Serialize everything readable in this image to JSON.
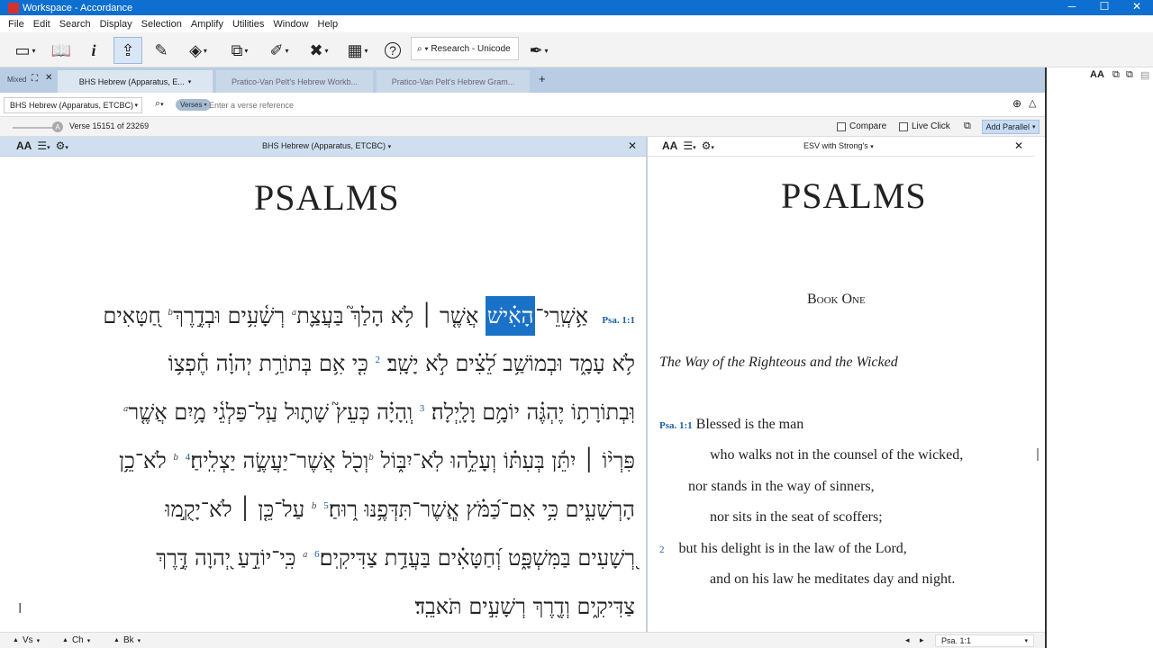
{
  "window": {
    "title": "Workspace - Accordance",
    "min": "─",
    "max": "☐",
    "close": "✕"
  },
  "menu": [
    "File",
    "Edit",
    "Search",
    "Display",
    "Selection",
    "Amplify",
    "Utilities",
    "Window",
    "Help"
  ],
  "toolbar": {
    "research_label": "⌕ ▾ Research - Unicode"
  },
  "tabs": {
    "mixed": "Mixed",
    "items": [
      "BHS Hebrew (Apparatus, E...",
      "Pratico-Van Pelt's Hebrew Workb...",
      "Pratico-Van Pelt's Hebrew Gram..."
    ],
    "add": "+"
  },
  "search": {
    "module": "BHS Hebrew (Apparatus, ETCBC)",
    "mode": "Verses",
    "placeholder": "Enter a verse reference"
  },
  "status": {
    "verse_count": "Verse 15151 of 23269",
    "compare": "Compare",
    "live_click": "Live Click",
    "add_parallel": "Add Parallel"
  },
  "left_pane": {
    "title": "BHS Hebrew (Apparatus, ETCBC)",
    "book": "PSALMS",
    "ref": "Psa. 1:1",
    "highlight": "הָאִ֗ישׁ",
    "line1_a": "אַ֥שְֽׁרֵי־",
    "line1_b": "אֲשֶׁ֤ר ׀ לֹ֥א הָלַךְ֮ בַּעֲצַ֪ת",
    "line1_c": " רְשָׁ֫עִ֥ים וּבְדֶ֣רֶךְ",
    "line1_d": " חַ֭טָּאִים",
    "line2": "לֹ֥א עָמָ֑ד וּבְמוֹשַׁ֥ב לֵ֝צִ֗ים לֹ֣א יָשָֽׁב׃",
    "line2_v": "2",
    "line2_b": "כִּ֤י אִ֥ם בְּתוֹרַ֥ת יְהוָ֗ה חֶ֫פְצ֥וֹ",
    "line3": "וּֽבְתוֹרָת֥וֹ יֶהְגֶּ֗ה יוֹמָ֥ם וָלָֽיְלָה׃",
    "line3_v": "3",
    "line3_b": "וְֽהָיָ֗ה כְּעֵץ֮ שָׁת֪וּל עַֽל־פַּלְגֵ֫י מָ֥יִם אֲשֶׁ֤ר",
    "line4_a": "פִּרְי֨וֹ ׀ יִתֵּ֬ן בְּעִתּ֗וֹ וְעָלֵ֥הוּ לֹֽא־יִבּ֑וֹל",
    "line4_b": "וְכֹ֖ל אֲשֶׁר־יַעֲשֶׂ֣ה יַצְלִֽיחַ׃",
    "line4_v": "4",
    "line4_c": "לֹא־כֵ֥ן",
    "line5_a": "הָרְשָׁעִ֑ים כִּ֥י אִם־כַּ֝מֹּ֗ץ אֲֽשֶׁר־תִּדְּפֶ֥נּוּ ר֑וּחַ׃",
    "line5_v": "5",
    "line5_b": "עַל־כֵּ֤ן ׀ לֹא־יָקֻ֣מוּ",
    "line6_a": "רְ֭שָׁעִים בַּמִּשְׁפָּ֑ט וְ֝חַטָּאִ֗ים בַּעֲדַ֥ת צַדִּיקִֽים׃",
    "line6_v": "6",
    "line6_b": "כִּֽי־יוֹדֵ֣עַ יְ֭הוָה דֶּ֣רֶךְ",
    "line7": "צַדִּיקִ֑ים וְדֶ֖רֶךְ רְשָׁעִ֣ים תֹּאבֵֽד׃",
    "sup_a": "a",
    "sup_b": "b"
  },
  "right_pane": {
    "title": "ESV with Strong's",
    "book": "PSALMS",
    "book_one": "Book One",
    "heading": "The Way of the Righteous and the Wicked",
    "ref": "Psa. 1:1",
    "v1_l1": "Blessed is the man",
    "v1_l2": "who walks not in the counsel of the wicked,",
    "v1_l3": "nor stands in the way of sinners,",
    "v1_l4": "nor sits in the seat of scoffers;",
    "v2_num": "2",
    "v2_l1": "but his delight is in the law of the Lord,",
    "v2_l2": "and on his law he meditates day and night."
  },
  "bottom": {
    "vs": "Vs",
    "ch": "Ch",
    "bk": "Bk",
    "ref": "Psa. 1:1"
  }
}
